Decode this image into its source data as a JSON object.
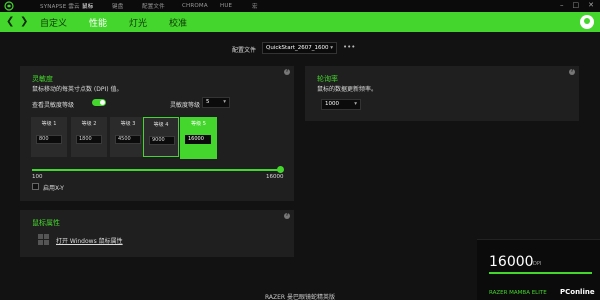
{
  "topnav": {
    "items": [
      "SYNAPSE 雲云",
      "鼠标",
      "键盘",
      "配置文件",
      "CHROMA",
      "HUE",
      "宏"
    ],
    "window_controls": [
      "–",
      "□",
      "✕"
    ]
  },
  "subnav": {
    "tabs": [
      "自定义",
      "性能",
      "灯光",
      "校准"
    ],
    "active": "性能"
  },
  "profile": {
    "label": "配置文件",
    "value": "QuickStart_2607_1600",
    "more": "•••"
  },
  "sensitivity": {
    "title": "灵敏度",
    "description": "鼠标移动的每英寸点数 (DPI) 值。",
    "toggle_label": "查看灵敏度等级",
    "toggle_on": true,
    "stages_label": "灵敏度等级",
    "stages_value": "5",
    "stages": [
      {
        "label": "等级 1",
        "value": "800"
      },
      {
        "label": "等级 2",
        "value": "1800"
      },
      {
        "label": "等级 3",
        "value": "4500"
      },
      {
        "label": "等级 4",
        "value": "9000"
      },
      {
        "label": "等级 5",
        "value": "16000"
      }
    ],
    "active_stage": 5,
    "slider_min": "100",
    "slider_max": "16000",
    "slider_fraction": 1.0,
    "xy_label": "启用X-Y",
    "xy_enabled": false
  },
  "polling": {
    "title": "轮询率",
    "description": "鼠标的数据更新频率。",
    "value": "1000"
  },
  "mouse_props": {
    "title": "鼠标属性",
    "link": "打开 Windows 鼠标属性"
  },
  "device": {
    "dpi": "16000",
    "dpi_unit": "DPI",
    "name": "RAZER MAMBA ELITE"
  },
  "watermark": "PConline",
  "footer": "RAZER 曼巴眼镜蛇精英版",
  "colors": {
    "accent": "#44d62c",
    "background": "#121212",
    "panel": "#1f1f1f"
  }
}
